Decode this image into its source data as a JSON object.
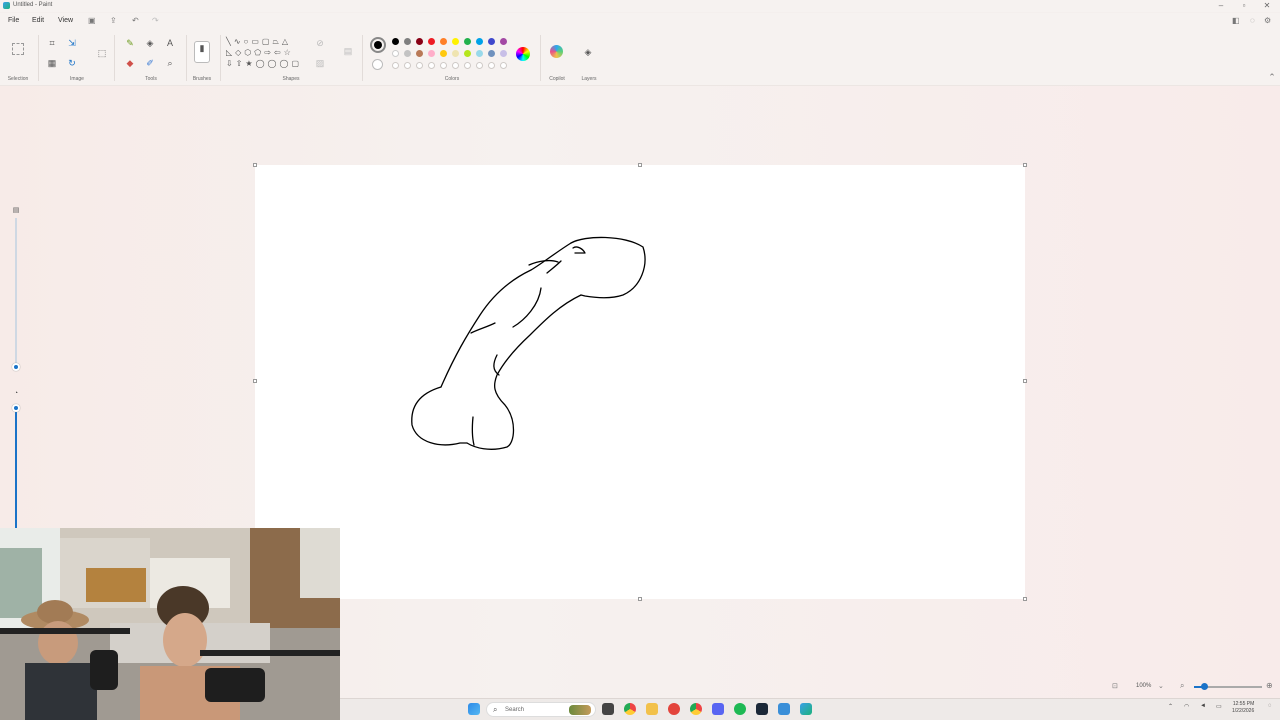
{
  "window": {
    "title": "Untitled - Paint"
  },
  "menu": {
    "file": "File",
    "edit": "Edit",
    "view": "View"
  },
  "ribbon": {
    "groups": {
      "selection": "Selection",
      "image": "Image",
      "tools": "Tools",
      "brushes": "Brushes",
      "shapes": "Shapes",
      "colors": "Colors",
      "copilot": "Copilot",
      "layers": "Layers"
    },
    "active_color": "#000000",
    "palette_row1": [
      "#000000",
      "#7f7f7f",
      "#880015",
      "#ed1c24",
      "#ff7f27",
      "#fff200",
      "#22b14c",
      "#00a2e8",
      "#3f48cc",
      "#a349a4"
    ],
    "palette_row2": [
      "#ffffff",
      "#c3c3c3",
      "#b97a57",
      "#ffaec9",
      "#ffc90e",
      "#efe4b0",
      "#b5e61d",
      "#99d9ea",
      "#7092be",
      "#c8bfe7"
    ]
  },
  "status": {
    "zoom": "100%"
  },
  "taskbar": {
    "search_placeholder": "Search",
    "time": "12:55 PM",
    "date": "1/22/2026"
  },
  "icons": [
    "windows-start-icon",
    "search-icon",
    "file-explorer-icon",
    "chrome-icon",
    "discord-icon",
    "spotify-icon",
    "steam-icon",
    "paint-icon",
    "settings-icon"
  ]
}
